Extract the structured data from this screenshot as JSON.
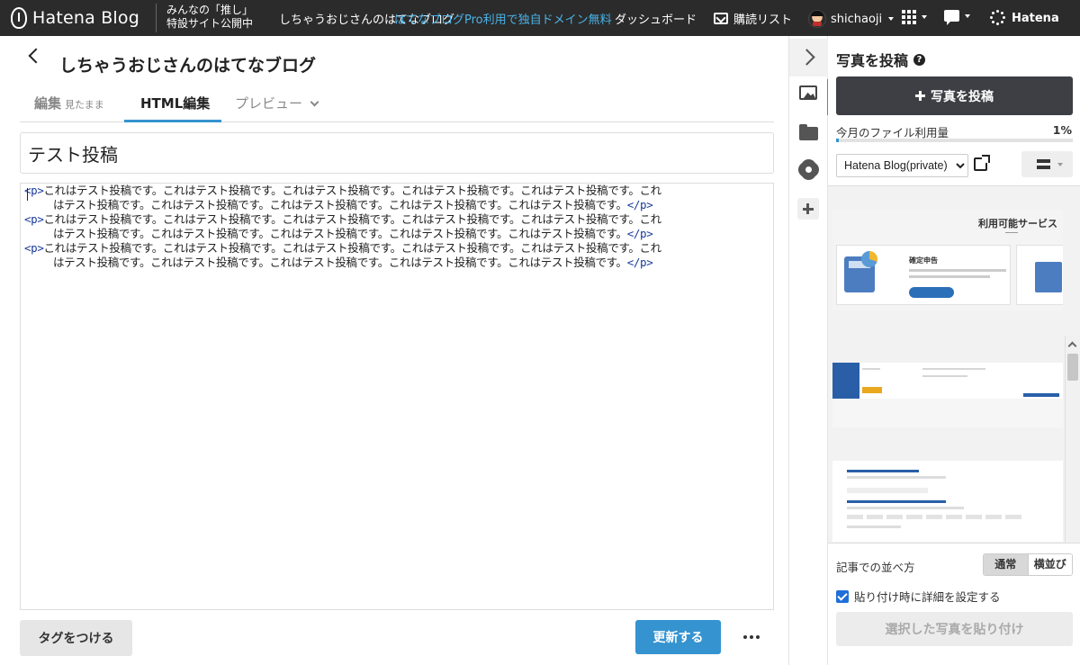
{
  "header": {
    "logo_text": "Hatena Blog",
    "promo_line1": "みんなの「推し」",
    "promo_line2": "特設サイト公開中",
    "blog_link": "しちゃうおじさんのはてなブログ",
    "pro_promo": "はてなブログPro利用で独自ドメイン無料",
    "dashboard": "ダッシュボード",
    "reading_list": "購読リスト",
    "username": "shichaoji",
    "brand": "Hatena"
  },
  "editor": {
    "blog_title": "しちゃうおじさんのはてなブログ",
    "tabs": {
      "edit_label": "編集",
      "edit_sub": "見たまま",
      "html_label": "HTML編集",
      "preview_label": "プレビュー"
    },
    "post_title": "テスト投稿",
    "code_lines": [
      "<p>これはテスト投稿です。これはテスト投稿です。これはテスト投稿です。これはテスト投稿です。これはテスト投稿です。これ",
      "はテスト投稿です。これはテスト投稿です。これはテスト投稿です。これはテスト投稿です。これはテスト投稿です。</p>",
      "<p>これはテスト投稿です。これはテスト投稿です。これはテスト投稿です。これはテスト投稿です。これはテスト投稿です。これ",
      "はテスト投稿です。これはテスト投稿です。これはテスト投稿です。これはテスト投稿です。これはテスト投稿です。</p>",
      "<p>これはテスト投稿です。これはテスト投稿です。これはテスト投稿です。これはテスト投稿です。これはテスト投稿です。これ",
      "はテスト投稿です。これはテスト投稿です。これはテスト投稿です。これはテスト投稿です。これはテスト投稿です。</p>"
    ],
    "tags_button": "タグをつける",
    "update_button": "更新する"
  },
  "panel": {
    "title": "写真を投稿",
    "help": "?",
    "post_photo_button": "写真を投稿",
    "usage_label": "今月のファイル利用量",
    "usage_pct_text": "1%",
    "usage_fraction": 0.01,
    "album_options": [
      "Hatena Blog(private)"
    ],
    "gallery_heading": "利用可能サービス",
    "gallery_card_name": "確定申告",
    "sort_label": "記事での並べ方",
    "sort_normal": "通常",
    "sort_horizontal": "横並び",
    "paste_detail_label": "貼り付け時に詳細を設定する",
    "paste_detail_checked": true,
    "paste_button": "選択した写真を貼り付け"
  },
  "colors": {
    "header_bg": "#2b2b2b",
    "accent_blue": "#3593d0",
    "pro_link": "#4ab3e8",
    "dark_button": "#3d3f44"
  }
}
